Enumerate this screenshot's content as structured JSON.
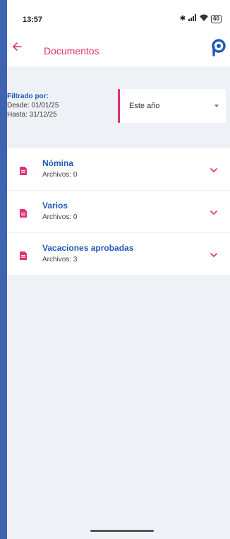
{
  "status_bar": {
    "time": "13:57",
    "battery": "60"
  },
  "app_bar": {
    "title": "Documentos",
    "accent_color": "#e0316f",
    "icons": [
      "arrow-left-icon",
      "brand-logo-icon"
    ]
  },
  "filter": {
    "title": "Filtrado por:",
    "from": "Desde: 01/01/25",
    "to": "Hasta: 31/12/25",
    "period_selected": "Este año"
  },
  "documents": [
    {
      "name": "Nómina",
      "count": "Archivos: 0"
    },
    {
      "name": "Varios",
      "count": "Archivos: 0"
    },
    {
      "name": "Vacaciones aprobadas",
      "count": "Archivos: 3"
    }
  ],
  "colors": {
    "primary_text": "#1f59b8",
    "accent": "#e0316f",
    "panel_bg": "#eef1f6"
  }
}
